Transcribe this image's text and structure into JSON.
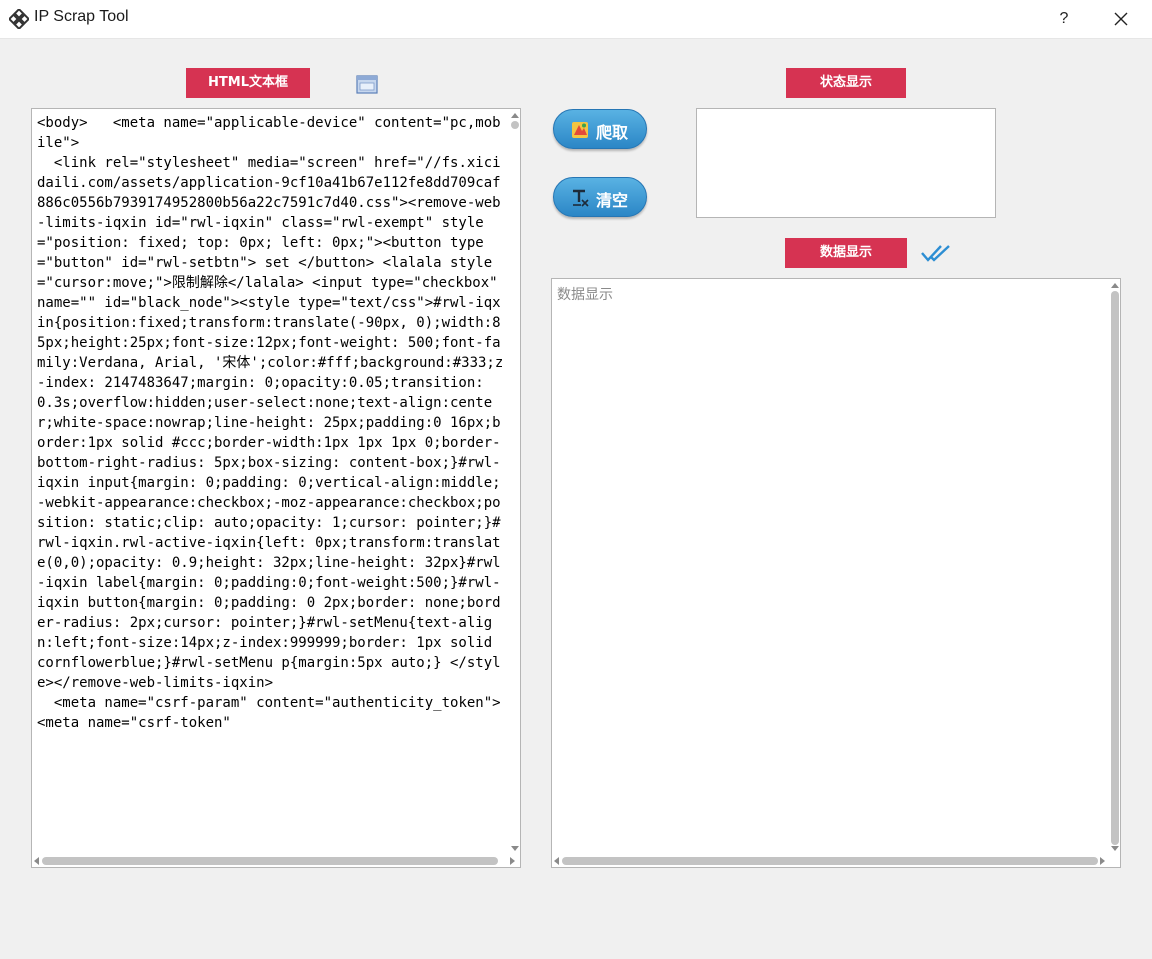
{
  "window": {
    "title": "IP Scrap Tool",
    "help_label": "?",
    "app_icon": "diamond-grid-icon",
    "close_icon": "close-icon"
  },
  "labels": {
    "html_box": "HTML文本框",
    "status": "状态显示",
    "data": "数据显示"
  },
  "buttons": {
    "crawl": {
      "label": "爬取",
      "icon": "crawl-icon"
    },
    "clear": {
      "label": "清空",
      "icon": "clear-format-icon"
    }
  },
  "html_editor": {
    "content": "<body>   <meta name=\"applicable-device\" content=\"pc,mobile\">\n  <link rel=\"stylesheet\" media=\"screen\" href=\"//fs.xicidaili.com/assets/application-9cf10a41b67e112fe8dd709caf886c0556b7939174952800b56a22c7591c7d40.css\"><remove-web-limits-iqxin id=\"rwl-iqxin\" class=\"rwl-exempt\" style=\"position: fixed; top: 0px; left: 0px;\"><button type=\"button\" id=\"rwl-setbtn\"> set </button> <lalala style=\"cursor:move;\">限制解除</lalala> <input type=\"checkbox\" name=\"\" id=\"black_node\"><style type=\"text/css\">#rwl-iqxin{position:fixed;transform:translate(-90px, 0);width:85px;height:25px;font-size:12px;font-weight: 500;font-family:Verdana, Arial, '宋体';color:#fff;background:#333;z-index: 2147483647;margin: 0;opacity:0.05;transition: 0.3s;overflow:hidden;user-select:none;text-align:center;white-space:nowrap;line-height: 25px;padding:0 16px;border:1px solid #ccc;border-width:1px 1px 1px 0;border-bottom-right-radius: 5px;box-sizing: content-box;}#rwl-iqxin input{margin: 0;padding: 0;vertical-align:middle;-webkit-appearance:checkbox;-moz-appearance:checkbox;position: static;clip: auto;opacity: 1;cursor: pointer;}#rwl-iqxin.rwl-active-iqxin{left: 0px;transform:translate(0,0);opacity: 0.9;height: 32px;line-height: 32px}#rwl-iqxin label{margin: 0;padding:0;font-weight:500;}#rwl-iqxin button{margin: 0;padding: 0 2px;border: none;border-radius: 2px;cursor: pointer;}#rwl-setMenu{text-align:left;font-size:14px;z-index:999999;border: 1px solid cornflowerblue;}#rwl-setMenu p{margin:5px auto;} </style></remove-web-limits-iqxin>\n  <meta name=\"csrf-param\" content=\"authenticity_token\">\n<meta name=\"csrf-token\""
  },
  "data_display": {
    "placeholder": "数据显示"
  },
  "icons": {
    "html_box_side": "browser-window-icon",
    "data_done": "double-check-icon"
  }
}
